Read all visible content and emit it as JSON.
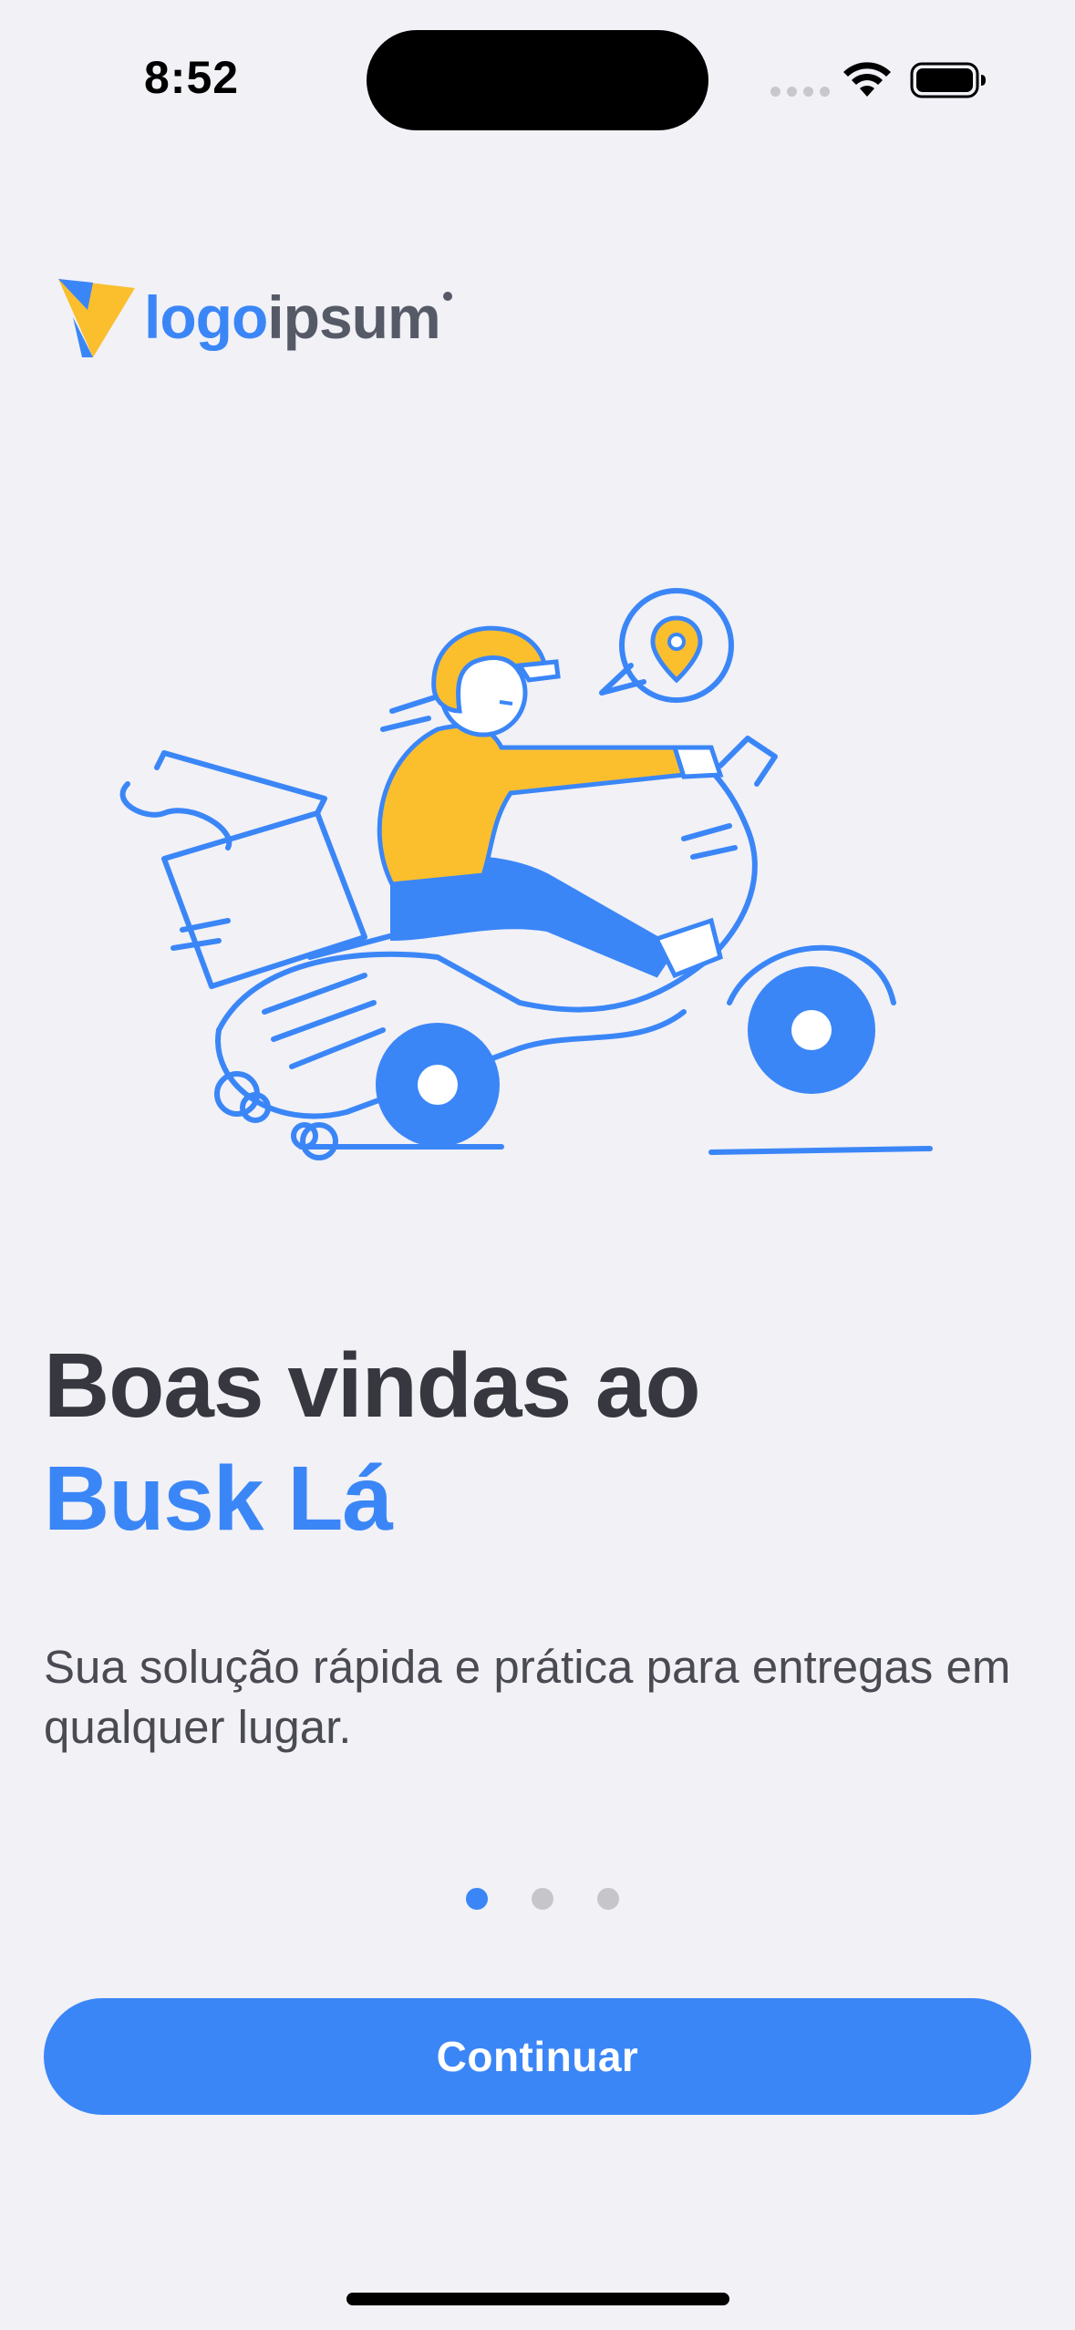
{
  "status_bar": {
    "time": "8:52"
  },
  "logo": {
    "part_a": "logo",
    "part_b": "ipsum"
  },
  "illustration": {
    "icon": "delivery-scooter-illustration"
  },
  "welcome": {
    "title_line": "Boas vindas ao",
    "brand_name": "Busk Lá",
    "subtitle": "Sua solução rápida e prática para entregas em qualquer lugar."
  },
  "pager": {
    "count": 3,
    "active_index": 0
  },
  "actions": {
    "continue_label": "Continuar"
  },
  "colors": {
    "accent": "#3b86f7",
    "yellow": "#fbbf2e",
    "background": "#f1f1f6",
    "heading": "#37373f"
  }
}
